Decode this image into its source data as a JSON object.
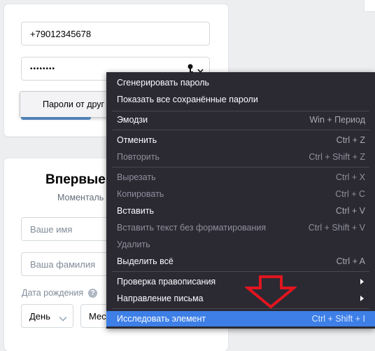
{
  "login": {
    "phone_value": "+79012345678",
    "password_mask": "••••••••",
    "passwords_button": "Пароли от друг"
  },
  "register": {
    "title": "Впервые",
    "subtitle": "Моменталь",
    "first_name_placeholder": "Ваше имя",
    "last_name_placeholder": "Ваша фамилия",
    "birthdate_label": "Дата рождения",
    "day_placeholder": "День",
    "month_placeholder": "Мес"
  },
  "context_menu": {
    "items": [
      {
        "label": "Сгенерировать пароль",
        "shortcut": ""
      },
      {
        "label": "Показать все сохранённые пароли",
        "shortcut": ""
      },
      {
        "label": "Эмодзи",
        "shortcut": "Win + Период"
      },
      {
        "label": "Отменить",
        "shortcut": "Ctrl + Z"
      },
      {
        "label": "Повторить",
        "shortcut": "Ctrl + Shift + Z"
      },
      {
        "label": "Вырезать",
        "shortcut": "Ctrl + X"
      },
      {
        "label": "Копировать",
        "shortcut": "Ctrl + C"
      },
      {
        "label": "Вставить",
        "shortcut": "Ctrl + V"
      },
      {
        "label": "Вставить текст без форматирования",
        "shortcut": "Ctrl + Shift + V"
      },
      {
        "label": "Удалить",
        "shortcut": ""
      },
      {
        "label": "Выделить всё",
        "shortcut": "Ctrl + A"
      },
      {
        "label": "Проверка правописания",
        "shortcut": ""
      },
      {
        "label": "Направление письма",
        "shortcut": ""
      },
      {
        "label": "Исследовать элемент",
        "shortcut": "Ctrl + Shift + I"
      }
    ]
  },
  "colors": {
    "menu_bg": "#2b2a33",
    "menu_highlight": "#3d7fe6",
    "arrow": "#e0151f",
    "button_blue": "#5181b8"
  }
}
